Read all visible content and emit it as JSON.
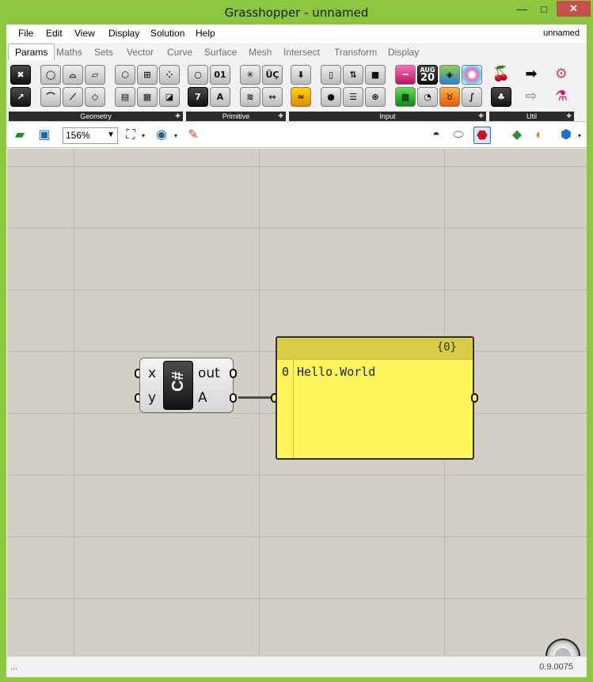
{
  "window": {
    "title": "Grasshopper - unnamed",
    "controls": {
      "minimize": "—",
      "maximize": "□",
      "close": "✕"
    }
  },
  "menubar": {
    "items": [
      "File",
      "Edit",
      "View",
      "Display",
      "Solution",
      "Help"
    ],
    "document_name": "unnamed"
  },
  "tabs": [
    {
      "label": "Params",
      "active": true
    },
    {
      "label": "Maths",
      "active": false
    },
    {
      "label": "Sets",
      "active": false
    },
    {
      "label": "Vector",
      "active": false
    },
    {
      "label": "Curve",
      "active": false
    },
    {
      "label": "Surface",
      "active": false
    },
    {
      "label": "Mesh",
      "active": false
    },
    {
      "label": "Intersect",
      "active": false
    },
    {
      "label": "Transform",
      "active": false
    },
    {
      "label": "Display",
      "active": false
    }
  ],
  "ribbon": {
    "groups": [
      {
        "label": "Geometry"
      },
      {
        "label": "Primitive"
      },
      {
        "label": "Input"
      },
      {
        "label": "Util"
      }
    ],
    "calendar": {
      "month": "AUG",
      "day": "20"
    }
  },
  "toolbar": {
    "zoom": "156%",
    "zoom_caret": "▾"
  },
  "canvas": {
    "script_component": {
      "badge": "C#",
      "inputs": [
        "x",
        "y"
      ],
      "outputs": [
        "out",
        "A"
      ]
    },
    "panel": {
      "path": "{0}",
      "rows": [
        {
          "index": "0",
          "value": "Hello.World"
        }
      ]
    }
  },
  "status": {
    "left": "...",
    "version": "0.9.0075"
  },
  "colors": {
    "window_frame": "#8cc63f",
    "close_button": "#c7504a",
    "canvas": "#d3cfc7",
    "panel": "#fff65a",
    "panel_header": "#d8cc46"
  }
}
